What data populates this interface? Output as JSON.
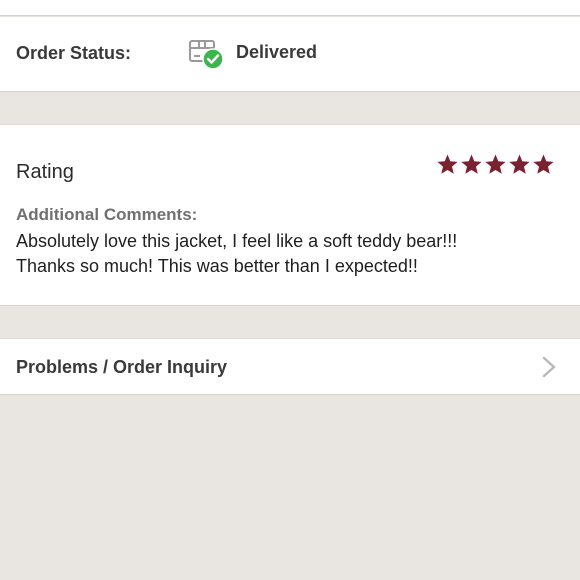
{
  "order_status": {
    "label": "Order Status:",
    "value": "Delivered",
    "icon": "package-delivered-icon",
    "check_color": "#3cb54a"
  },
  "rating": {
    "label": "Rating",
    "stars": 5,
    "max_stars": 5,
    "star_color": "#7b2231"
  },
  "comments": {
    "label": "Additional Comments:",
    "lines": [
      "Absolutely love this jacket, I feel like a soft teddy bear!!!",
      "Thanks so much! This was better than I expected!!"
    ]
  },
  "inquiry": {
    "label": "Problems / Order Inquiry",
    "icon": "chevron-right-icon"
  }
}
